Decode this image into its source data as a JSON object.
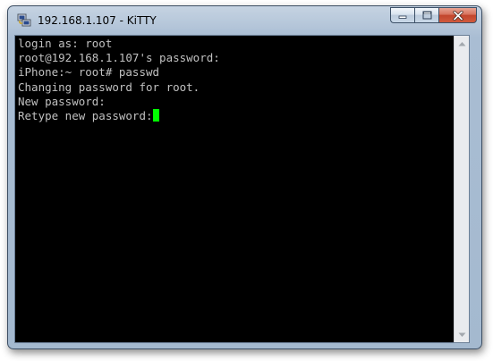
{
  "window": {
    "title": "192.168.1.107 - KiTTY",
    "app_icon": "putty-computers-icon",
    "buttons": [
      "minimize",
      "maximize",
      "close"
    ]
  },
  "terminal": {
    "lines": [
      "login as: root",
      "root@192.168.1.107's password:",
      "iPhone:~ root# passwd",
      "Changing password for root.",
      "New password:",
      "Retype new password:"
    ],
    "text_color": "#c0c0c0",
    "background_color": "#000000",
    "cursor_color": "#00ff00"
  }
}
